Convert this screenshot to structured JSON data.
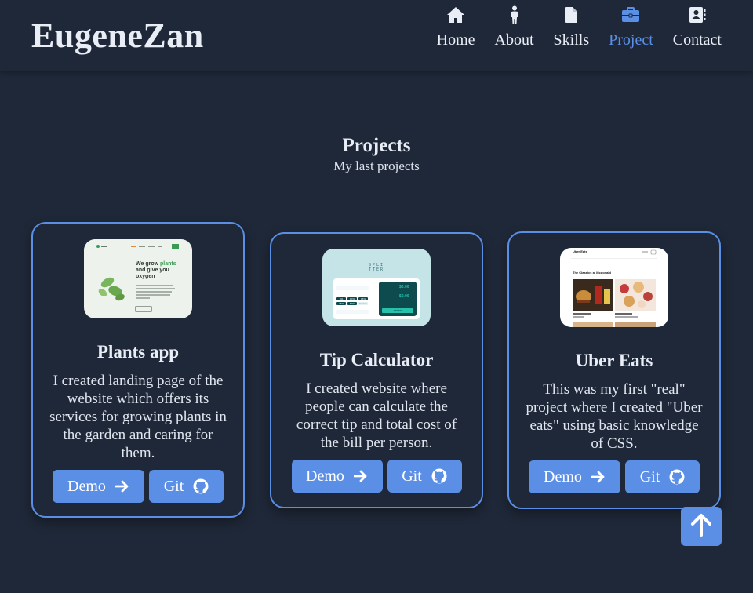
{
  "header": {
    "logo": "EugeneZan",
    "nav": [
      {
        "label": "Home",
        "icon": "home-icon"
      },
      {
        "label": "About",
        "icon": "person-icon"
      },
      {
        "label": "Skills",
        "icon": "file-icon"
      },
      {
        "label": "Project",
        "icon": "briefcase-icon",
        "active": true
      },
      {
        "label": "Contact",
        "icon": "contact-book-icon"
      }
    ]
  },
  "section": {
    "title": "Projects",
    "subtitle": "My last projects"
  },
  "projects": [
    {
      "title": "Plants app",
      "description": "I created landing page of the website which offers its services for growing plants in the garden and caring for them.",
      "demo_label": "Demo",
      "git_label": "Git",
      "thumb": {
        "heading_a": "We grow ",
        "heading_accent": "plants",
        "heading_b": "and give you",
        "heading_c": "oxygen"
      }
    },
    {
      "title": "Tip Calculator",
      "description": "I created website where people can calculate the correct tip and total cost of the bill per person.",
      "demo_label": "Demo",
      "git_label": "Git",
      "thumb": {
        "logo_a": "SPLI",
        "logo_b": "TTER",
        "tips": [
          "5%",
          "10%",
          "15%",
          "25%",
          "50%",
          "Custom"
        ],
        "amount_1": "$0.00",
        "amount_2": "$0.00",
        "reset": "RESET"
      }
    },
    {
      "title": "Uber Eats",
      "description": "This was my first \"real\" project where I created \"Uber eats\" using basic knowledge of CSS.",
      "demo_label": "Demo",
      "git_label": "Git",
      "thumb": {
        "brand": "Uber Eats",
        "heading": "The Classics at Mcdonald"
      }
    }
  ],
  "colors": {
    "background": "#1f2838",
    "accent": "#5b8fe6",
    "text": "#e9eef6"
  }
}
